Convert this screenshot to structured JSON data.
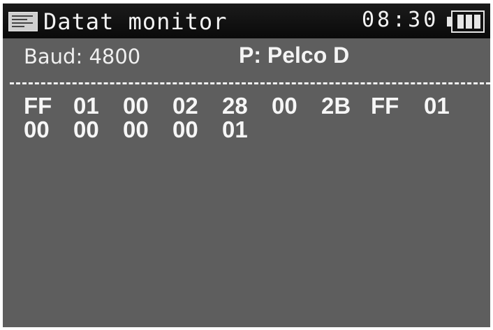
{
  "titlebar": {
    "title": "Datat monitor",
    "time": "08:30",
    "app_icon": "data-monitor-icon",
    "battery_icon": "battery-full-icon"
  },
  "settings": {
    "baud_label": "Baud:",
    "baud_value": "4800",
    "protocol_label": "P:",
    "protocol_value": "Pelco D"
  },
  "received_bytes": {
    "line1": [
      "FF",
      "01",
      "00",
      "02",
      "28",
      "00",
      "2B",
      "FF",
      "01"
    ],
    "line2": [
      "00",
      "00",
      "00",
      "00",
      "01"
    ]
  },
  "colors": {
    "screen_background": "#5e5e5e",
    "titlebar_background": "#0a0a0a",
    "text": "#f2f2f2"
  }
}
